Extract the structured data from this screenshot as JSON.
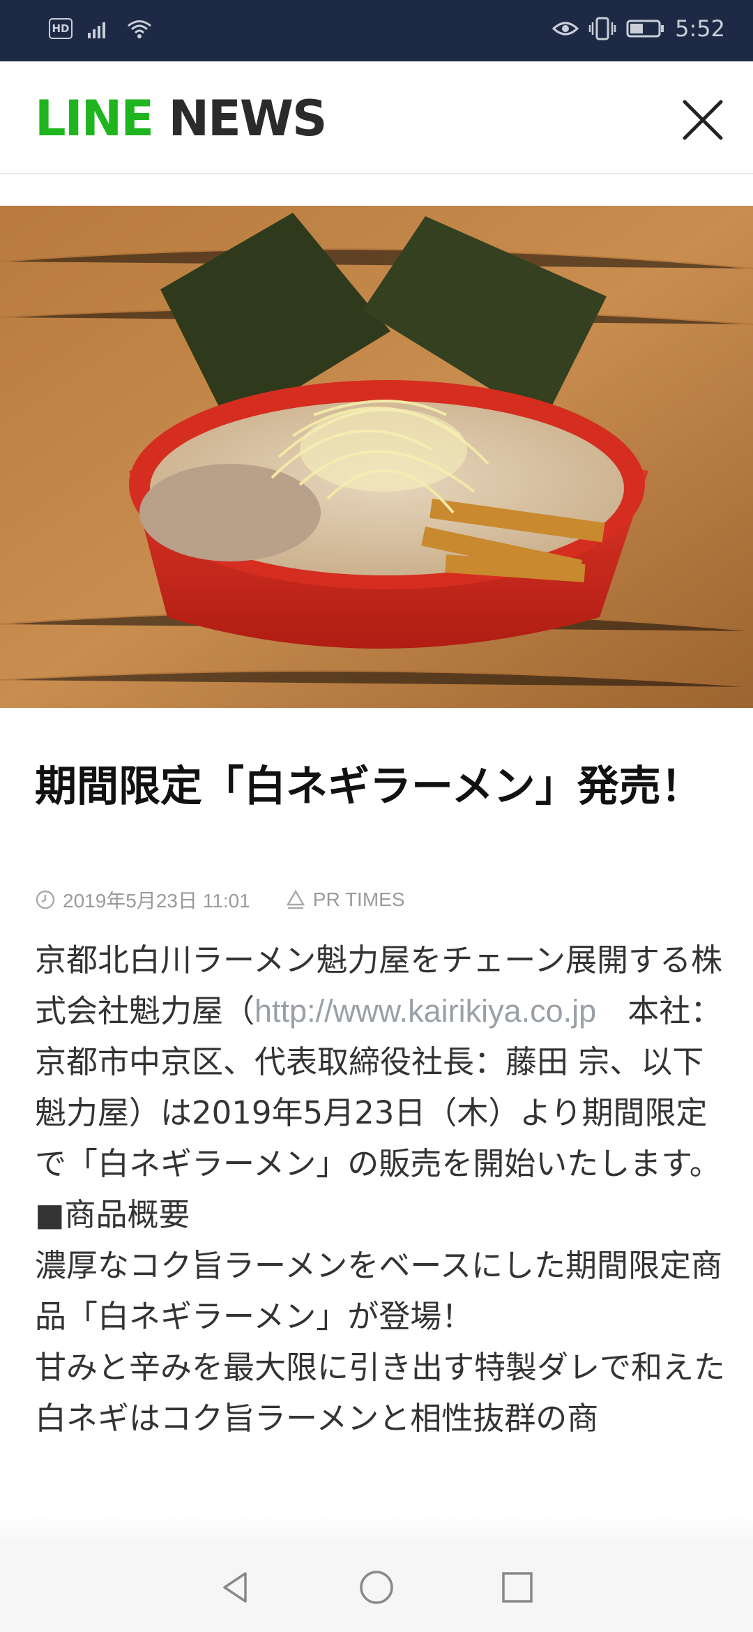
{
  "status_bar": {
    "hd_label": "HD",
    "time": "5:52",
    "icons": [
      "signal-icon",
      "wifi-icon",
      "eye-icon",
      "vibrate-icon",
      "battery-icon"
    ]
  },
  "header": {
    "logo_line": "LINE",
    "logo_news": "NEWS",
    "close_icon": "close-icon"
  },
  "colors": {
    "status_bar_bg": "#1e2a45",
    "logo_green": "#1eb51e",
    "logo_dark": "#2b2b2b",
    "link": "#9aa0a6"
  },
  "article": {
    "title": "期間限定「白ネギラーメン」発売！",
    "date": "2019年5月23日 11:01",
    "source": "PR TIMES",
    "body": {
      "p1_before": "京都北白川ラーメン魁力屋をチェーン展開する株式会社魁力屋（",
      "link": "http://www.kairikiya.co.jp",
      "p1_after": "　本社：京都市中京区、代表取締役社長：藤田 宗、以下魁力屋）は2019年5月23日（木）より期間限定で「白ネギラーメン」の販売を開始いたします。",
      "section": "■商品概要",
      "p2": "濃厚なコク旨ラーメンをベースにした期間限定商品「白ネギラーメン」が登場！",
      "p3": "甘みと辛みを最大限に引き出す特製ダレで和えた白ネギはコク旨ラーメンと相性抜群の商"
    }
  },
  "nav": {
    "icons": [
      "back-icon",
      "home-icon",
      "recents-icon"
    ]
  }
}
